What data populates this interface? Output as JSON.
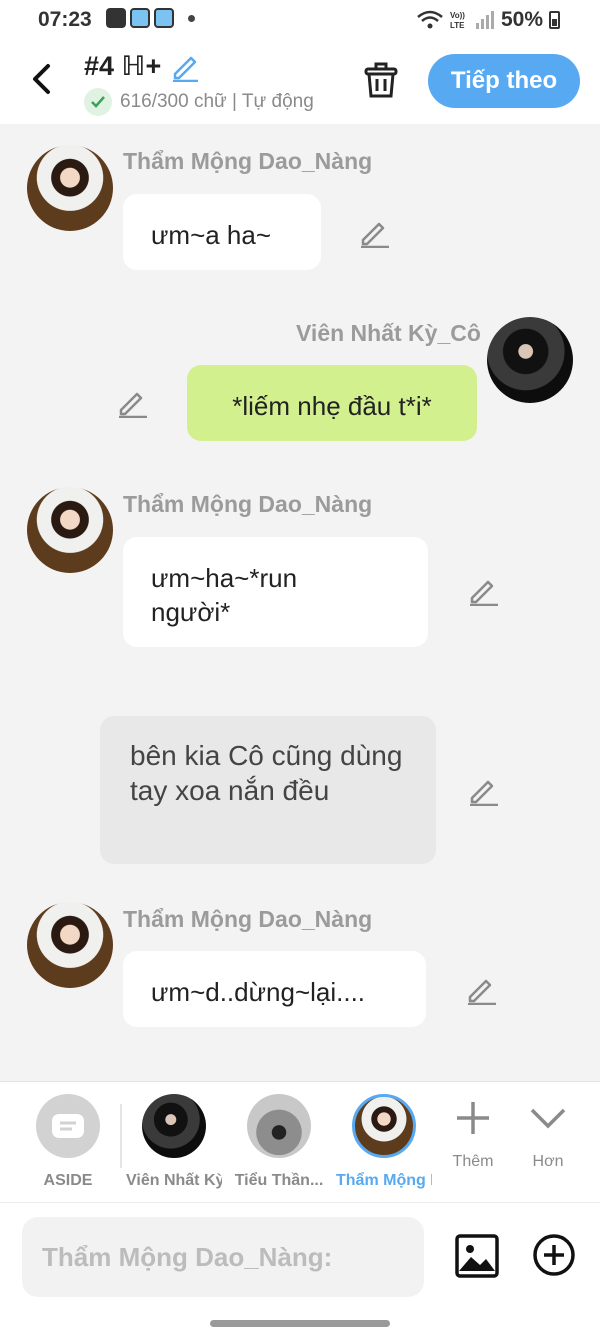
{
  "status_bar": {
    "time": "07:23",
    "battery": "50%",
    "icons": [
      "gallery-icon",
      "cat-app-icon",
      "cat-app-icon",
      "dot-icon",
      "wifi-icon",
      "volte-icon",
      "signal-icon",
      "battery-icon"
    ]
  },
  "header": {
    "title": "#4 ℍ+",
    "word_count": "616/300 chữ",
    "mode": "Tự động",
    "next_label": "Tiếp theo"
  },
  "messages": [
    {
      "type": "other",
      "sender": "Thẩm Mộng Dao_Nàng",
      "text": "ưm~a ha~"
    },
    {
      "type": "me",
      "sender": "Viên Nhất Kỳ_Cô",
      "text": "*liếm nhẹ đầu t*i*"
    },
    {
      "type": "other",
      "sender": "Thẩm Mộng Dao_Nàng",
      "text": "ưm~ha~*run người*"
    },
    {
      "type": "aside",
      "text": "bên kia Cô cũng dùng tay xoa nắn đều"
    },
    {
      "type": "other",
      "sender": "Thẩm Mộng Dao_Nàng",
      "text": "ưm~d..dừng~lại...."
    }
  ],
  "character_bar": {
    "items": [
      {
        "label": "ASIDE",
        "active": false
      },
      {
        "label": "Viên Nhất Kỳ_Cô",
        "active": false
      },
      {
        "label": "Tiểu Thần...",
        "active": false
      },
      {
        "label": "Thẩm Mộng Dao_Nàng",
        "active": true
      }
    ],
    "add_label": "Thêm",
    "more_label": "Hơn"
  },
  "input": {
    "placeholder": "Thẩm Mộng Dao_Nàng:"
  },
  "colors": {
    "accent": "#57a9f2",
    "my_bubble": "#d3f08e",
    "aside_bubble": "#e8e8e8",
    "background": "#f3f3f3"
  }
}
